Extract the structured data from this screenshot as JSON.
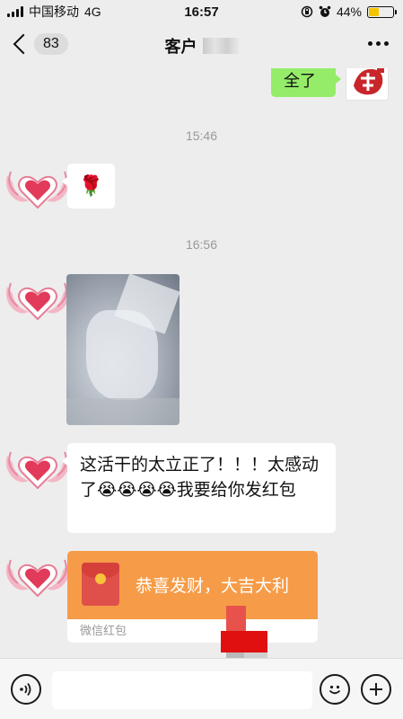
{
  "status_bar": {
    "carrier": "中国移动",
    "network": "4G",
    "time": "16:57",
    "battery": "44%",
    "battery_level": 0.44
  },
  "nav": {
    "unread_count": "83",
    "title": "客户"
  },
  "messages": {
    "sent_text": "全了",
    "time_1": "15:46",
    "rose": "🌹",
    "time_2": "16:56",
    "received_text": "这活干的太立正了！！！太感动了😭😭😭😭我要给你发红包",
    "red_packet_title": "恭喜发财，大吉大利",
    "red_packet_label": "微信红包"
  },
  "colors": {
    "sent_bubble": "#95ec69",
    "red_packet": "#f69c48"
  },
  "icons": {
    "voice": "voice-icon",
    "emoji": "emoji-icon",
    "plus": "plus-icon"
  }
}
